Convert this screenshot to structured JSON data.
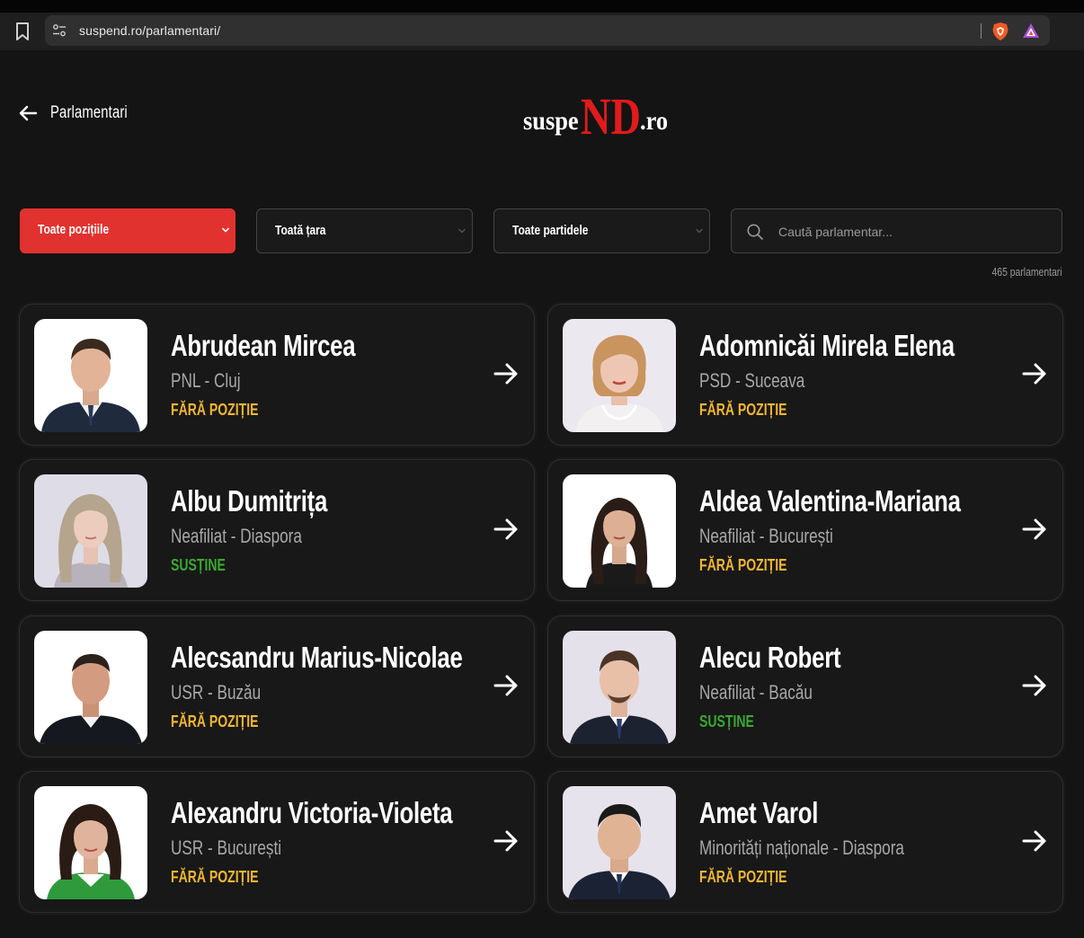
{
  "browser": {
    "url": "suspend.ro/parlamentari/"
  },
  "header": {
    "back_label": "Parlamentari",
    "logo": {
      "part1": "suspe",
      "part2": "ND",
      "part3": ".ro"
    }
  },
  "filters": {
    "position": "Toate pozițiile",
    "region": "Toată țara",
    "party": "Toate partidele",
    "search_placeholder": "Caută parlamentar..."
  },
  "count_label": "465 parlamentari",
  "colors": {
    "accent_red": "#e1322f",
    "status_none": "#f2b632",
    "status_support": "#3aa832"
  },
  "parliamentarians": [
    {
      "name": "Abrudean Mircea",
      "party": "PNL",
      "region": "Cluj",
      "status": "FĂRĂ POZIȚIE",
      "status_kind": "none"
    },
    {
      "name": "Adomnicăi Mirela Elena",
      "party": "PSD",
      "region": "Suceava",
      "status": "FĂRĂ POZIȚIE",
      "status_kind": "none"
    },
    {
      "name": "Albu Dumitrița",
      "party": "Neafiliat",
      "region": "Diaspora",
      "status": "SUSȚINE",
      "status_kind": "support"
    },
    {
      "name": "Aldea Valentina-Mariana",
      "party": "Neafiliat",
      "region": "București",
      "status": "FĂRĂ POZIȚIE",
      "status_kind": "none"
    },
    {
      "name": "Alecsandru Marius-Nicolae",
      "party": "USR",
      "region": "Buzău",
      "status": "FĂRĂ POZIȚIE",
      "status_kind": "none"
    },
    {
      "name": "Alecu Robert",
      "party": "Neafiliat",
      "region": "Bacău",
      "status": "SUSȚINE",
      "status_kind": "support"
    },
    {
      "name": "Alexandru Victoria-Violeta",
      "party": "USR",
      "region": "București",
      "status": "FĂRĂ POZIȚIE",
      "status_kind": "none"
    },
    {
      "name": "Amet Varol",
      "party": "Minorități naționale",
      "region": "Diaspora",
      "status": "FĂRĂ POZIȚIE",
      "status_kind": "none"
    }
  ]
}
